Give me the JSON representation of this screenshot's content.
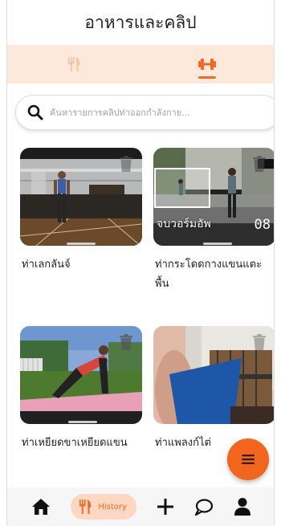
{
  "header": {
    "title": "อาหารและคลิป"
  },
  "tabs": [
    {
      "icon": "fork-knife-icon",
      "active": false
    },
    {
      "icon": "dumbbell-icon",
      "active": true
    }
  ],
  "search": {
    "placeholder": "ค้นหารายการคลิปท่าออกกำลังกาย..."
  },
  "clips": [
    {
      "title": "ท่าเลกลันจ์",
      "overlay": ""
    },
    {
      "title": "ท่ากระโดดกางแขนแตะพื้น",
      "overlay": "จบวอร์มอัพ",
      "number": "08"
    },
    {
      "title": "ท่าเหยียดขาเหยียดแขน",
      "overlay": ""
    },
    {
      "title": "ท่าแพลงก์ไต่",
      "overlay": ""
    }
  ],
  "nav": {
    "history_label": "History",
    "items": [
      "home-icon",
      "fork-knife-icon",
      "plus-icon",
      "chat-icon",
      "user-icon"
    ]
  },
  "colors": {
    "accent": "#f06a24",
    "tab_bg": "#fde9dc",
    "pill_bg": "#fcd8c2"
  }
}
